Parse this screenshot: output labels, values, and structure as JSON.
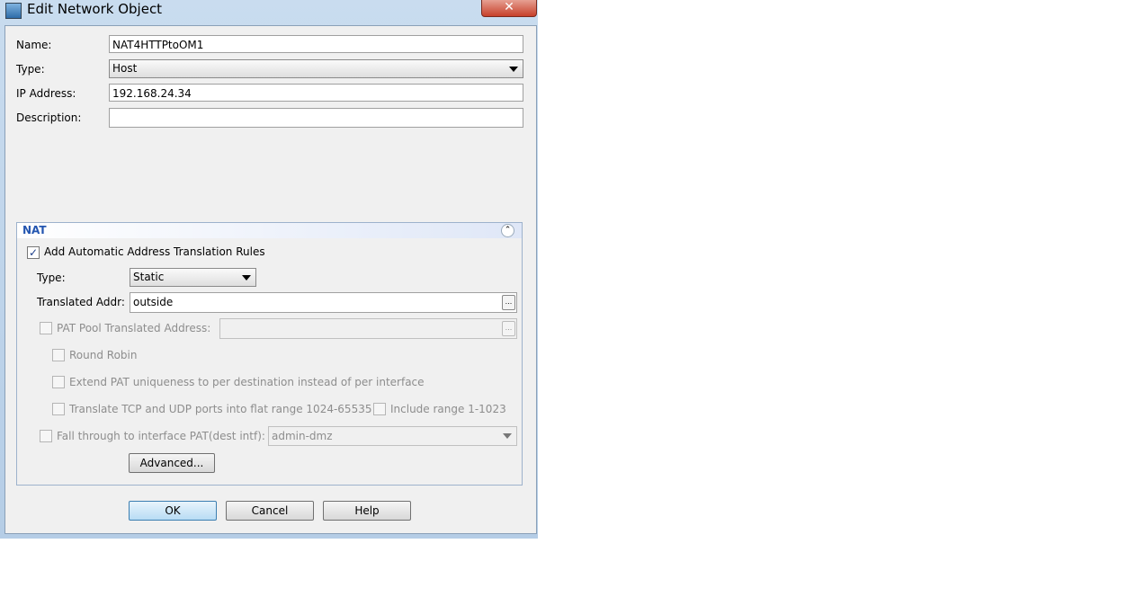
{
  "window": {
    "title": "Edit Network Object",
    "close_label": "✕"
  },
  "form": {
    "name_label": "Name:",
    "name_value": "NAT4HTTPtoOM1",
    "type_label": "Type:",
    "type_value": "Host",
    "ip_label": "IP Address:",
    "ip_value": "192.168.24.34",
    "description_label": "Description:",
    "description_value": ""
  },
  "nat": {
    "section_title": "NAT",
    "collapse_icon": "chevron-double-up-icon",
    "auto_rules_label": "Add Automatic Address Translation Rules",
    "auto_rules_checked": true,
    "type_label": "Type:",
    "type_value": "Static",
    "translated_label": "Translated Addr:",
    "translated_value": "outside",
    "browse_label": "...",
    "pat_pool_label": "PAT Pool Translated Address:",
    "pat_pool_value": "",
    "round_robin_label": "Round Robin",
    "extend_label": "Extend PAT uniqueness to per destination instead of per interface",
    "flat_label": "Translate TCP and UDP ports into flat range 1024-65535",
    "include_label": "Include range 1-1023",
    "fall_label": "Fall through to interface PAT(dest intf):",
    "fall_value": "admin-dmz",
    "advanced_label": "Advanced..."
  },
  "buttons": {
    "ok": "OK",
    "cancel": "Cancel",
    "help": "Help"
  }
}
